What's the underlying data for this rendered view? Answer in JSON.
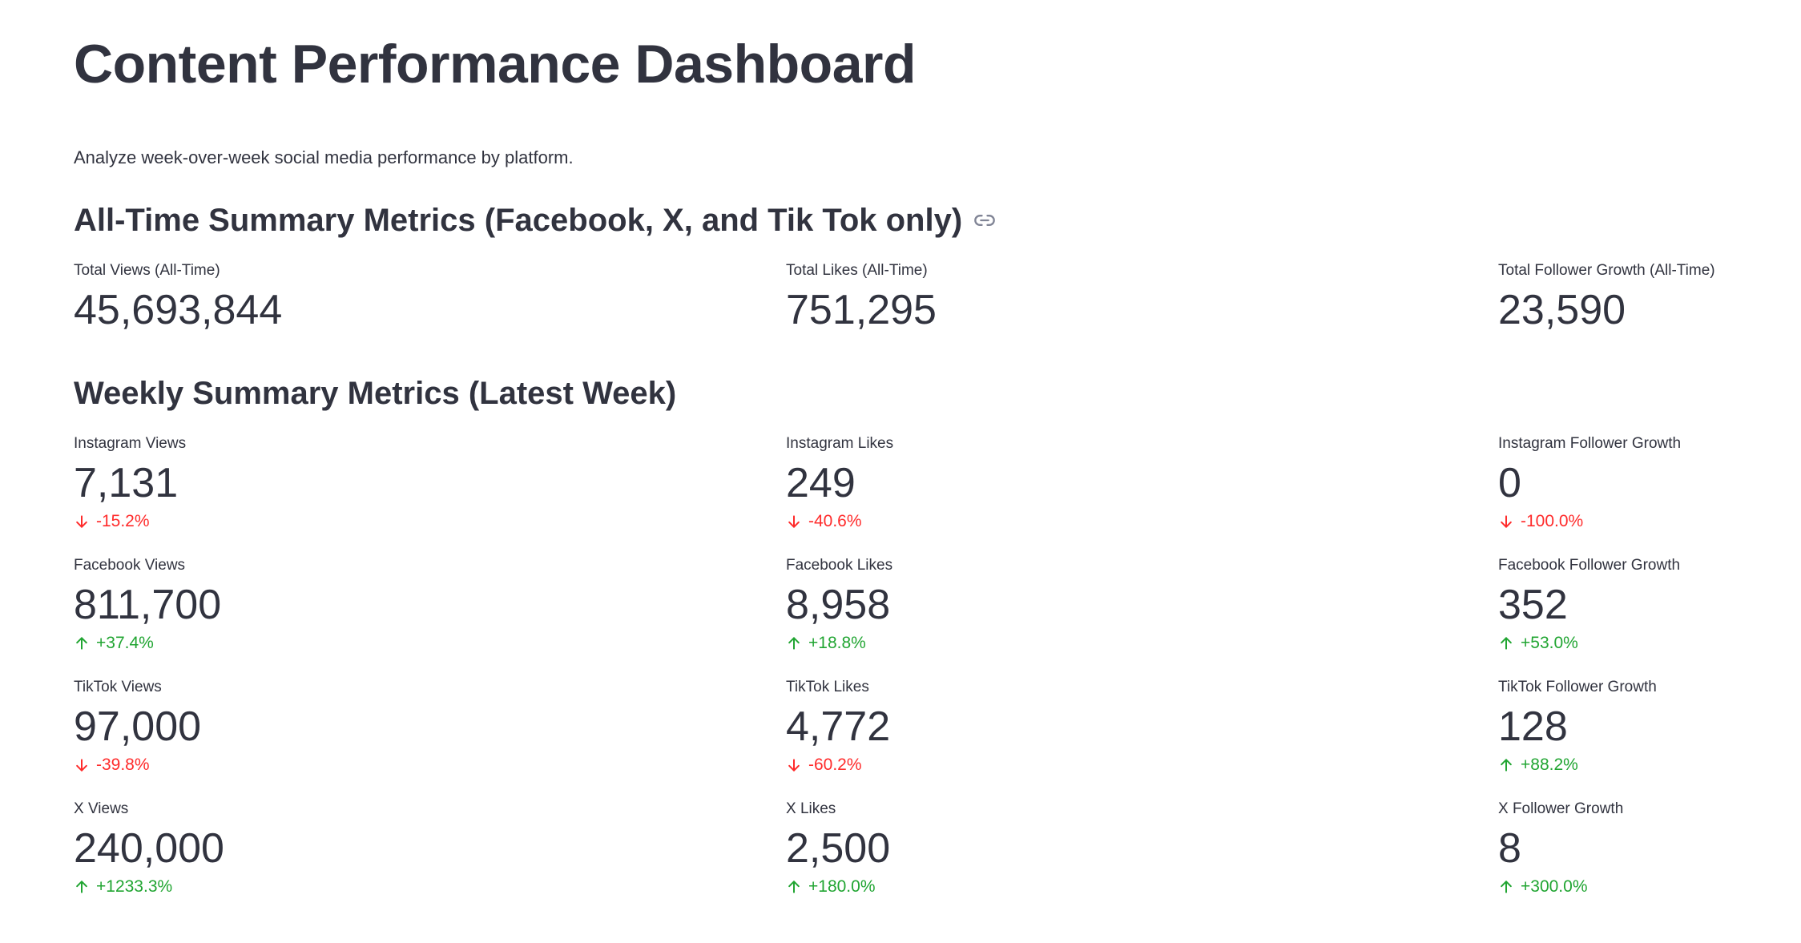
{
  "page": {
    "title": "Content Performance Dashboard",
    "subtitle": "Analyze week-over-week social media performance by platform."
  },
  "colors": {
    "text": "#31333f",
    "negative": "#ff2b2b",
    "positive": "#21a532",
    "icon": "#808495"
  },
  "all_time": {
    "heading": "All-Time Summary Metrics (Facebook, X, and Tik Tok only)",
    "anchor_icon": "link-icon",
    "metrics": [
      {
        "label": "Total Views (All-Time)",
        "value": "45,693,844"
      },
      {
        "label": "Total Likes (All-Time)",
        "value": "751,295"
      },
      {
        "label": "Total Follower Growth (All-Time)",
        "value": "23,590"
      }
    ]
  },
  "weekly": {
    "heading": "Weekly Summary Metrics (Latest Week)",
    "metrics": [
      {
        "label": "Instagram Views",
        "value": "7,131",
        "delta": "-15.2%",
        "direction": "down"
      },
      {
        "label": "Instagram Likes",
        "value": "249",
        "delta": "-40.6%",
        "direction": "down"
      },
      {
        "label": "Instagram Follower Growth",
        "value": "0",
        "delta": "-100.0%",
        "direction": "down"
      },
      {
        "label": "Facebook Views",
        "value": "811,700",
        "delta": "+37.4%",
        "direction": "up"
      },
      {
        "label": "Facebook Likes",
        "value": "8,958",
        "delta": "+18.8%",
        "direction": "up"
      },
      {
        "label": "Facebook Follower Growth",
        "value": "352",
        "delta": "+53.0%",
        "direction": "up"
      },
      {
        "label": "TikTok Views",
        "value": "97,000",
        "delta": "-39.8%",
        "direction": "down"
      },
      {
        "label": "TikTok Likes",
        "value": "4,772",
        "delta": "-60.2%",
        "direction": "down"
      },
      {
        "label": "TikTok Follower Growth",
        "value": "128",
        "delta": "+88.2%",
        "direction": "up"
      },
      {
        "label": "X Views",
        "value": "240,000",
        "delta": "+1233.3%",
        "direction": "up"
      },
      {
        "label": "X Likes",
        "value": "2,500",
        "delta": "+180.0%",
        "direction": "up"
      },
      {
        "label": "X Follower Growth",
        "value": "8",
        "delta": "+300.0%",
        "direction": "up"
      }
    ]
  }
}
